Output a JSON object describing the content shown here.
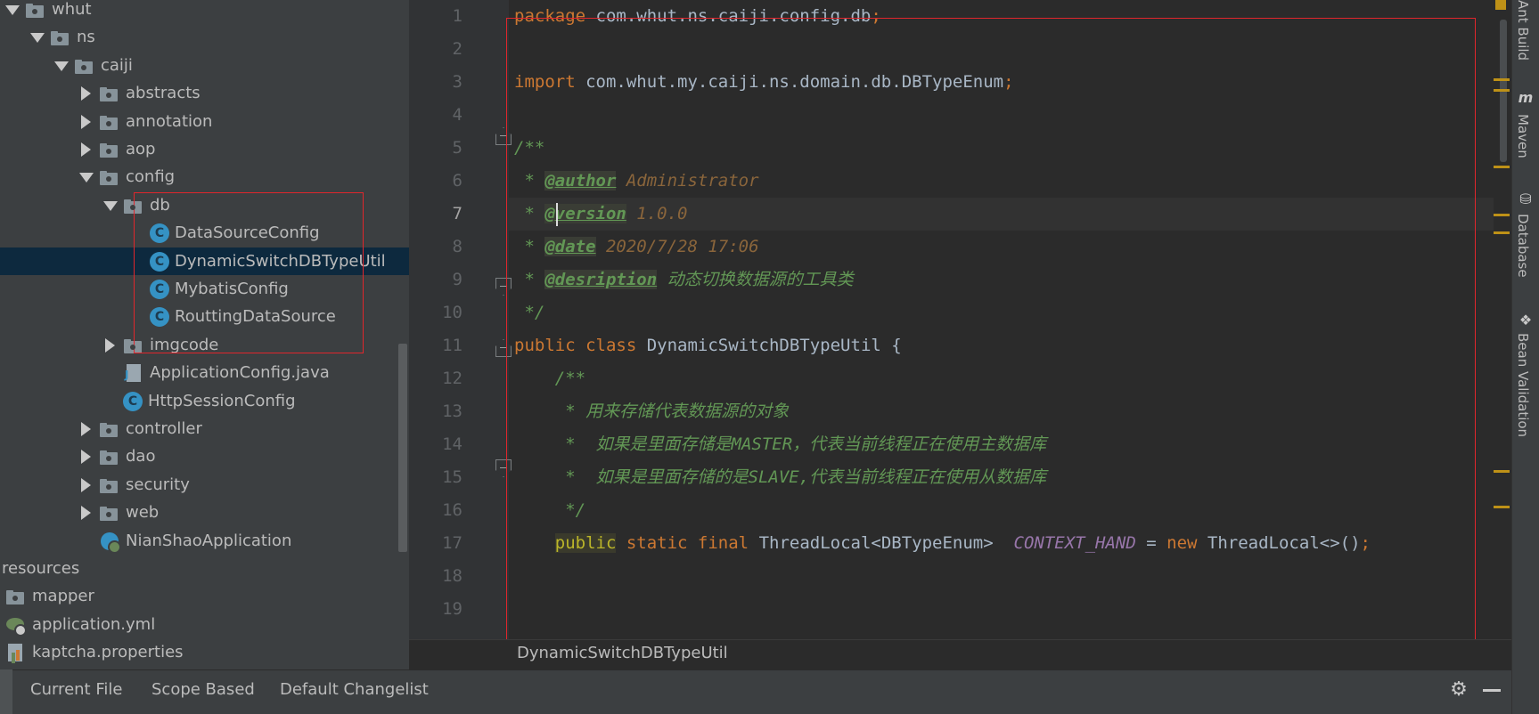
{
  "tree": {
    "items": [
      {
        "label": "whut",
        "arrow": "open",
        "icon": "folder-icon"
      },
      {
        "label": "ns",
        "arrow": "open",
        "icon": "folder-icon"
      },
      {
        "label": "caiji",
        "arrow": "open",
        "icon": "folder-icon"
      },
      {
        "label": "abstracts",
        "arrow": "closed",
        "icon": "folder-icon"
      },
      {
        "label": "annotation",
        "arrow": "closed",
        "icon": "folder-icon"
      },
      {
        "label": "aop",
        "arrow": "closed",
        "icon": "folder-icon"
      },
      {
        "label": "config",
        "arrow": "open",
        "icon": "folder-icon"
      },
      {
        "label": "db",
        "arrow": "open",
        "icon": "folder-icon"
      },
      {
        "label": "DataSourceConfig",
        "arrow": "none",
        "icon": "class-icon"
      },
      {
        "label": "DynamicSwitchDBTypeUtil",
        "arrow": "none",
        "icon": "class-icon",
        "selected": true
      },
      {
        "label": "MybatisConfig",
        "arrow": "none",
        "icon": "class-icon"
      },
      {
        "label": "RouttingDataSource",
        "arrow": "none",
        "icon": "class-icon"
      },
      {
        "label": "imgcode",
        "arrow": "closed",
        "icon": "folder-icon"
      },
      {
        "label": "ApplicationConfig.java",
        "arrow": "none",
        "icon": "java-file-icon"
      },
      {
        "label": "HttpSessionConfig",
        "arrow": "none",
        "icon": "class-icon"
      },
      {
        "label": "controller",
        "arrow": "closed",
        "icon": "folder-icon"
      },
      {
        "label": "dao",
        "arrow": "closed",
        "icon": "folder-icon"
      },
      {
        "label": "security",
        "arrow": "closed",
        "icon": "folder-icon"
      },
      {
        "label": "web",
        "arrow": "closed",
        "icon": "folder-icon"
      },
      {
        "label": "NianShaoApplication",
        "arrow": "none",
        "icon": "spring-app-icon"
      },
      {
        "label": "resources",
        "arrow": "none",
        "icon": "none"
      },
      {
        "label": "mapper",
        "arrow": "none",
        "icon": "folder-icon"
      },
      {
        "label": "application.yml",
        "arrow": "none",
        "icon": "yml-file-icon"
      },
      {
        "label": "kaptcha.properties",
        "arrow": "none",
        "icon": "properties-file-icon"
      }
    ],
    "class_glyph": "C"
  },
  "editor": {
    "line_numbers": [
      "1",
      "2",
      "3",
      "4",
      "5",
      "6",
      "7",
      "8",
      "9",
      "10",
      "11",
      "12",
      "13",
      "14",
      "15",
      "16",
      "17",
      "18",
      "19"
    ],
    "current_line": "7",
    "code": {
      "l1_kw": "package",
      "l1_rest": " com.whut.ns.caiji.config.db",
      "l1_semi": ";",
      "l3_kw": "import",
      "l3_rest": " com.whut.my.caiji.ns.domain.db.DBTypeEnum",
      "l3_semi": ";",
      "l5": "/**",
      "l6_star": " * ",
      "l6_tag": "@author",
      "l6_text": " Administrator",
      "l7_star": " * ",
      "l7_tag": "@version",
      "l7_text": " 1.0.0",
      "l8_star": " * ",
      "l8_tag": "@date",
      "l8_text": " 2020/7/28 17:06",
      "l9_star": " * ",
      "l9_tag": "@desription",
      "l9_text": " 动态切换数据源的工具类",
      "l10": " */",
      "l11_kw": "public class",
      "l11_rest": " DynamicSwitchDBTypeUtil {",
      "l12": "    /**",
      "l13": "     * 用来存储代表数据源的对象",
      "l14": "     *  如果是里面存储是MASTER，代表当前线程正在使用主数据库",
      "l15": "     *  如果是里面存储的是SLAVE,代表当前线程正在使用从数据库",
      "l16": "     */",
      "l17_indent": "    ",
      "l17_public": "public",
      "l17_kw": " static final",
      "l17_type": " ThreadLocal<DBTypeEnum>  ",
      "l17_field": "CONTEXT_HAND",
      "l17_eq": " = ",
      "l17_new": "new",
      "l17_rest": " ThreadLocal<>()",
      "l17_semi": ";"
    }
  },
  "breadcrumb": "DynamicSwitchDBTypeUtil",
  "right_tools": [
    "Ant Build",
    "Maven",
    "Database",
    "Bean Validation"
  ],
  "right_tool_icons": {
    "maven": "m"
  },
  "bottom_tabs": [
    "Current File",
    "Scope Based",
    "Default Changelist"
  ],
  "colors": {
    "keyword": "#cc7832",
    "comment": "#629755",
    "static_field": "#9876aa",
    "selection": "#0d293e",
    "highlight_box": "#e0262c"
  }
}
